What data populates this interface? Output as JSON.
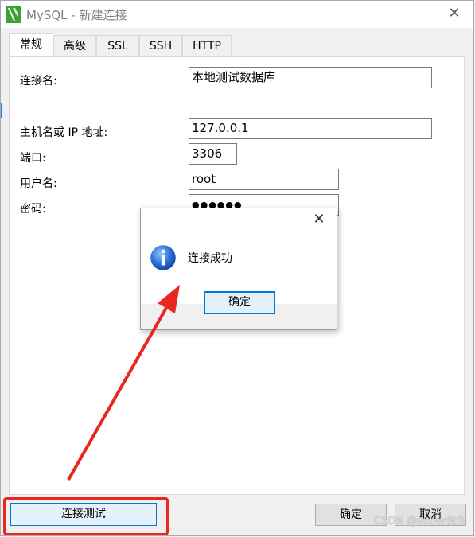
{
  "window": {
    "title": "MySQL - 新建连接"
  },
  "tabs": [
    {
      "label": "常规",
      "active": true
    },
    {
      "label": "高级",
      "active": false
    },
    {
      "label": "SSL",
      "active": false
    },
    {
      "label": "SSH",
      "active": false
    },
    {
      "label": "HTTP",
      "active": false
    }
  ],
  "form": {
    "connection_name_label": "连接名:",
    "connection_name_value": "本地测试数据库",
    "host_label": "主机名或 IP 地址:",
    "host_value": "127.0.0.1",
    "port_label": "端口:",
    "port_value": "3306",
    "user_label": "用户名:",
    "user_value": "root",
    "password_label": "密码:",
    "password_value": "●●●●●●"
  },
  "dialog": {
    "message": "连接成功",
    "ok_label": "确定"
  },
  "footer": {
    "test_label": "连接测试",
    "ok_label": "确定",
    "cancel_label": "取消"
  },
  "watermark": "CSDN @super先生",
  "colors": {
    "highlight": "#e8281e",
    "arrow": "#e8281e",
    "focus_border": "#0078d7"
  }
}
